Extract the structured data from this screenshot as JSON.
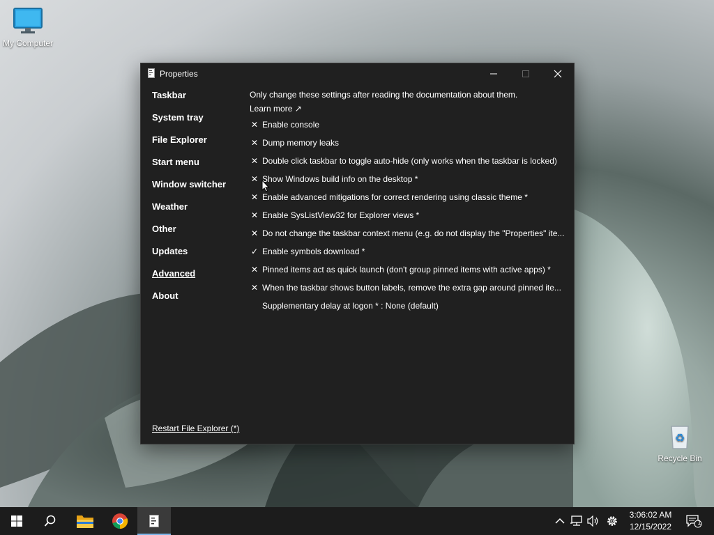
{
  "desktop": {
    "icons": [
      {
        "label": "My Computer"
      },
      {
        "label": "Recycle Bin"
      }
    ]
  },
  "window": {
    "title": "Properties",
    "nav": [
      {
        "label": "Taskbar"
      },
      {
        "label": "System tray"
      },
      {
        "label": "File Explorer"
      },
      {
        "label": "Start menu"
      },
      {
        "label": "Window switcher"
      },
      {
        "label": "Weather"
      },
      {
        "label": "Other"
      },
      {
        "label": "Updates"
      },
      {
        "label": "Advanced",
        "active": true
      },
      {
        "label": "About"
      }
    ],
    "notice": "Only change these settings after reading the documentation about them.",
    "learn_more": "Learn more ↗",
    "options": [
      {
        "label": "Enable console",
        "mark": "✕"
      },
      {
        "label": "Dump memory leaks",
        "mark": "✕"
      },
      {
        "label": "Double click taskbar to toggle auto-hide (only works when the taskbar is locked)",
        "mark": "✕"
      },
      {
        "label": "Show Windows build info on the desktop *",
        "mark": "✕"
      },
      {
        "label": "Enable advanced mitigations for correct rendering using classic theme *",
        "mark": "✕"
      },
      {
        "label": "Enable SysListView32 for Explorer views *",
        "mark": "✕"
      },
      {
        "label": "Do not change the taskbar context menu (e.g. do not display the \"Properties\" ite...",
        "mark": "✕"
      },
      {
        "label": "Enable symbols download *",
        "mark": "✓"
      },
      {
        "label": "Pinned items act as quick launch (don't group pinned items with active apps) *",
        "mark": "✕"
      },
      {
        "label": "When the taskbar shows button labels, remove the extra gap around pinned ite...",
        "mark": "✕"
      },
      {
        "label": "Supplementary delay at logon * : None (default)",
        "mark": ""
      }
    ],
    "restart": "Restart File Explorer (*)"
  },
  "taskbar": {
    "time": "3:06:02 AM",
    "date": "12/15/2022",
    "notification_count": "1"
  },
  "colors": {
    "window_bg": "#202020",
    "taskbar_bg": "#1c1c1c",
    "accent": "#7ab4e8"
  }
}
